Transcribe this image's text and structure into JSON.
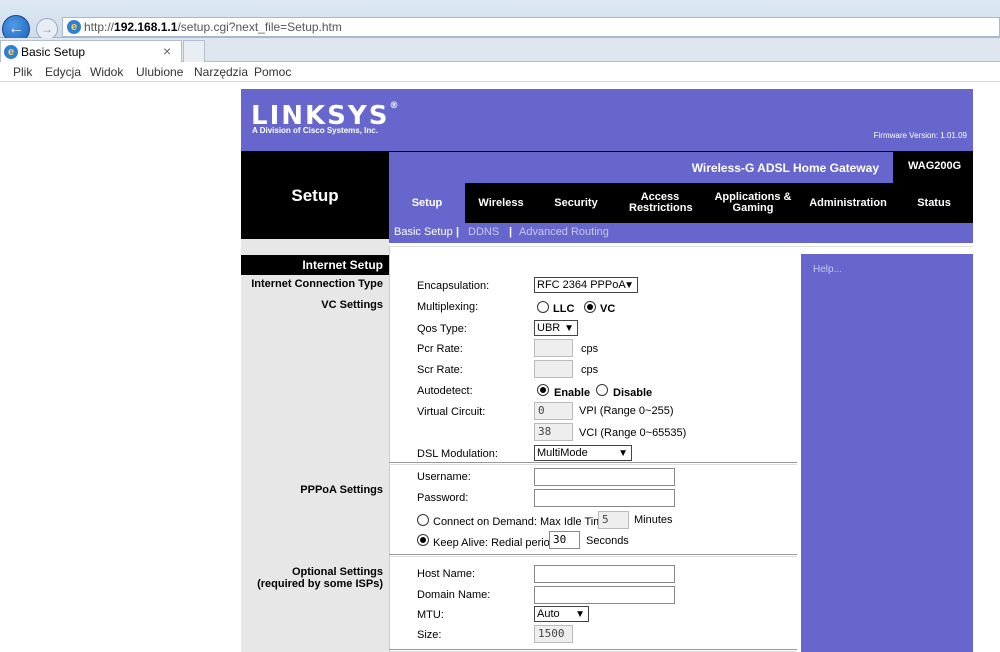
{
  "browser": {
    "url_prefix": "http://",
    "url_host": "192.168.1.1",
    "url_path": "/setup.cgi?next_file=Setup.htm",
    "tab_title": "Basic Setup",
    "tab_close": "×",
    "menu": [
      "Plik",
      "Edycja",
      "Widok",
      "Ulubione",
      "Narzędzia",
      "Pomoc"
    ]
  },
  "header": {
    "logo": "LINKSYS",
    "logo_reg": "®",
    "logo_sub": "A Division of Cisco Systems, Inc.",
    "firmware": "Firmware Version: 1.01.09",
    "product_name": "Wireless-G ADSL Home Gateway",
    "model": "WAG200G",
    "section": "Setup"
  },
  "nav": {
    "tabs": [
      {
        "label": "Setup",
        "active": true
      },
      {
        "label": "Wireless",
        "active": false
      },
      {
        "label": "Security",
        "active": false
      },
      {
        "label": "Access Restrictions",
        "active": false
      },
      {
        "label": "Applications & Gaming",
        "active": false
      },
      {
        "label": "Administration",
        "active": false
      },
      {
        "label": "Status",
        "active": false
      }
    ],
    "subtabs": {
      "basic": "Basic Setup",
      "sep": "|",
      "ddns": "DDNS",
      "advanced": "Advanced Routing"
    }
  },
  "left": {
    "internet_setup": "Internet Setup",
    "connection_type": "Internet Connection Type",
    "vc_settings": "VC Settings",
    "pppoa_settings": "PPPoA Settings",
    "optional_settings": "Optional Settings",
    "optional_note": "(required by some ISPs)"
  },
  "form": {
    "encapsulation_label": "Encapsulation:",
    "encapsulation_value": "RFC 2364 PPPoA",
    "multiplexing_label": "Multiplexing:",
    "llc": "LLC",
    "vc": "VC",
    "qos_label": "Qos Type:",
    "qos_value": "UBR",
    "pcr_label": "Pcr Rate:",
    "pcr_value": "",
    "scr_label": "Scr Rate:",
    "scr_value": "",
    "cps": "cps",
    "autodetect_label": "Autodetect:",
    "enable": "Enable",
    "disable": "Disable",
    "vc_label": "Virtual Circuit:",
    "vpi_value": "0",
    "vpi_text": "VPI (Range 0~255)",
    "vci_value": "38",
    "vci_text": "VCI (Range 0~65535)",
    "dsl_label": "DSL Modulation:",
    "dsl_value": "MultiMode",
    "username_label": "Username:",
    "username_value": "",
    "password_label": "Password:",
    "password_value": "",
    "cod_text": "Connect on Demand: Max Idle Time",
    "cod_value": "5",
    "minutes": "Minutes",
    "keepalive_text": "Keep Alive: Redial period",
    "keepalive_value": "30",
    "seconds": "Seconds",
    "host_label": "Host Name:",
    "host_value": "",
    "domain_label": "Domain Name:",
    "domain_value": "",
    "mtu_label": "MTU:",
    "mtu_value": "Auto",
    "size_label": "Size:",
    "size_value": "1500"
  },
  "help": {
    "text": "Help..."
  },
  "colors": {
    "brand": "#6666cc",
    "nav_bg": "#000000"
  }
}
